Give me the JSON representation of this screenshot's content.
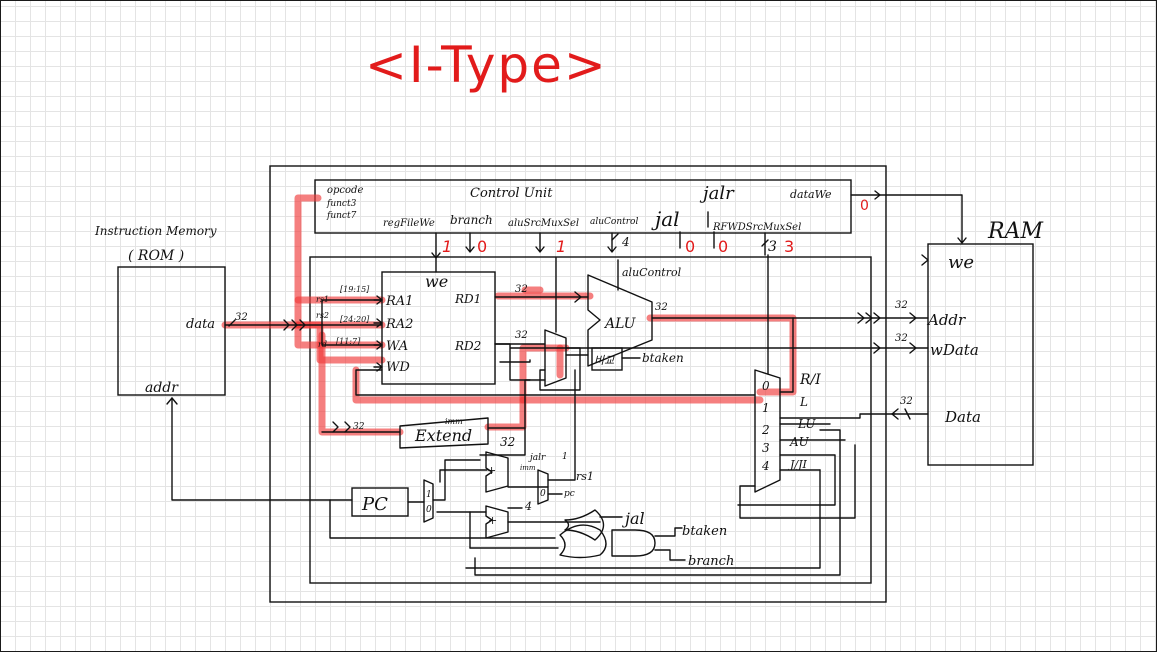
{
  "title": "<I-Type>",
  "instruction_memory": {
    "label_line1": "Instruction Memory",
    "label_line2": "( ROM )",
    "data_port": "data",
    "addr_port": "addr",
    "bus_width": "32"
  },
  "control_unit": {
    "title": "Control Unit",
    "inputs": [
      "opcode",
      "funct3",
      "funct7"
    ],
    "signals": [
      {
        "name": "regFileWe",
        "value": "1"
      },
      {
        "name": "branch",
        "value": "0"
      },
      {
        "name": "aluSrcMuxSel",
        "value": "1"
      },
      {
        "name": "aluControl",
        "value": "4"
      },
      {
        "name": "jal",
        "value": "0"
      },
      {
        "name": "jalr",
        "value": "0"
      },
      {
        "name": "RFWDSrcMuxSel",
        "value": "3"
      },
      {
        "name": "dataWe",
        "value": "0"
      }
    ],
    "alucontrol_width": "4",
    "rfwd_width": "3"
  },
  "register_file": {
    "we": "we",
    "ports_in": [
      "RA1",
      "RA2",
      "WA",
      "WD"
    ],
    "ports_out": [
      "RD1",
      "RD2"
    ],
    "field_labels": [
      "[19:15]",
      "rs1",
      "rs2",
      "[24:20]",
      "rd",
      "[11:7]"
    ],
    "bus_width": "32"
  },
  "alu": {
    "label": "ALU",
    "control_label": "aluControl",
    "compare_label": "비교",
    "btaken": "btaken",
    "bus_width": "32"
  },
  "extend": {
    "label": "Extend",
    "imm_label": "imm",
    "width_in": "32",
    "width_out": "32"
  },
  "pc_block": {
    "pc": "PC",
    "plus": "+",
    "four": "4",
    "mux_in": [
      "1",
      "0"
    ],
    "jalr_label": "jalr",
    "imm_label": "imm",
    "rs1_label": "rs1",
    "pc_label": "pc",
    "jalr_sel": "1",
    "pc_sel": "0"
  },
  "writeback_mux": {
    "inputs": [
      "0",
      "1",
      "2",
      "3",
      "4"
    ],
    "labels": [
      "R/I",
      "L",
      "LU",
      "AU",
      "J/JI"
    ]
  },
  "branch_logic": {
    "jal": "jal",
    "btaken": "btaken",
    "branch": "branch"
  },
  "ram": {
    "label": "RAM",
    "we": "we",
    "addr": "Addr",
    "wdata": "wData",
    "rdata": "Data",
    "bus_width": "32"
  },
  "colors": {
    "highlight": "#ef3b3b",
    "title": "#e21b1b",
    "ink": "#111111"
  }
}
